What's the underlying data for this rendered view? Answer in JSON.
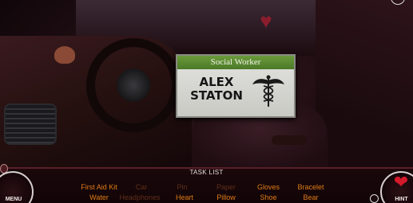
{
  "name_card": {
    "title": "Social Worker",
    "name_line1": "ALEX",
    "name_line2": "STATON",
    "header_color": "#5a8a32",
    "emblem": "caduceus-icon"
  },
  "hud": {
    "task_list_title": "TASK LIST",
    "menu_label": "MENU",
    "hint_label": "HINT",
    "hint_icon": "heart-icon",
    "found_color": "#5f2f1a",
    "remaining_color": "#e07b16",
    "tasks_row1": [
      {
        "label": "First Aid Kit",
        "found": false
      },
      {
        "label": "Car",
        "found": true
      },
      {
        "label": "Pin",
        "found": true
      },
      {
        "label": "Paper",
        "found": true
      },
      {
        "label": "Gloves",
        "found": false
      },
      {
        "label": "Bracelet",
        "found": false
      }
    ],
    "tasks_row2": [
      {
        "label": "Water",
        "found": false
      },
      {
        "label": "Headphones",
        "found": true
      },
      {
        "label": "Heart",
        "found": false
      },
      {
        "label": "Pillow",
        "found": false
      },
      {
        "label": "Shoe",
        "found": false
      },
      {
        "label": "Bear",
        "found": false
      }
    ]
  }
}
